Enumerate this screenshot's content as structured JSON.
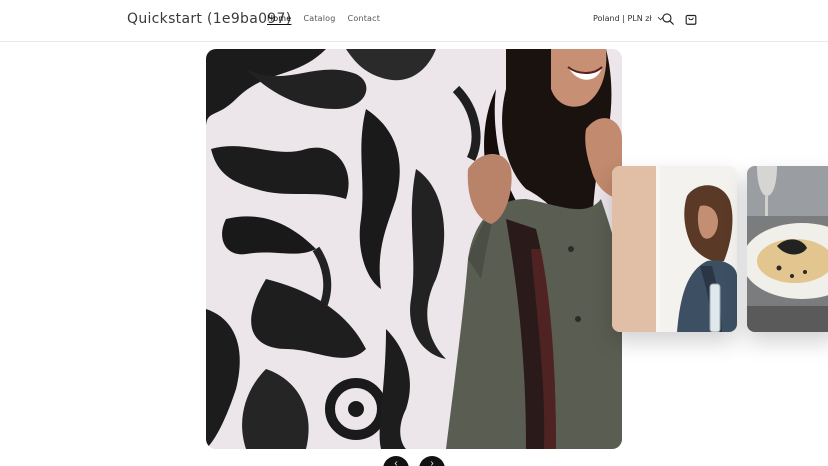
{
  "header": {
    "logo": "Quickstart (1e9ba097)",
    "nav": [
      {
        "label": "Home",
        "active": true
      },
      {
        "label": "Catalog",
        "active": false
      },
      {
        "label": "Contact",
        "active": false
      }
    ],
    "locale": "Poland | PLN zł",
    "search_icon": "search-icon",
    "cart_icon": "cart-icon"
  },
  "hero": {
    "image": "woman-laughing-graffiti-wall"
  },
  "cards": [
    {
      "image": "woman-curly-hair-denim-jacket"
    },
    {
      "image": "pasta-dish-with-wine"
    }
  ],
  "slider": {
    "prev_icon": "chevron-left-icon",
    "next_icon": "chevron-right-icon"
  }
}
